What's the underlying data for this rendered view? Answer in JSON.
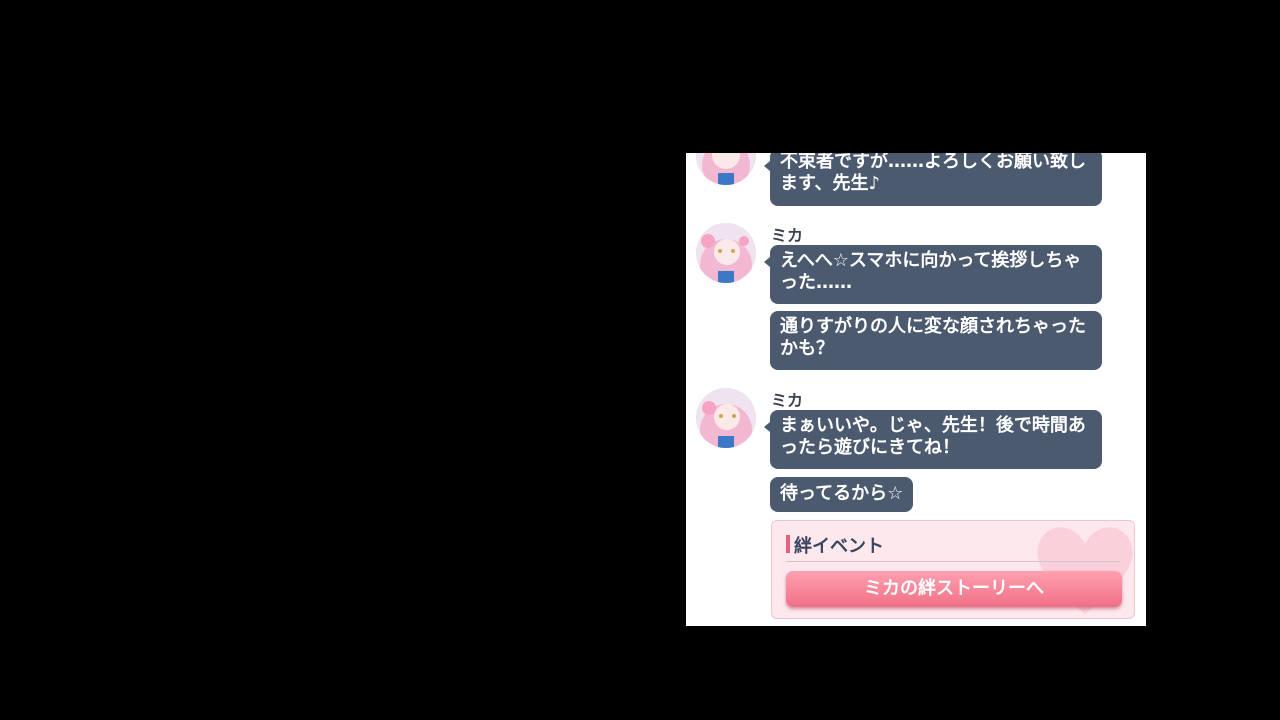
{
  "chat": {
    "partial_message": {
      "text": "不束者ですが……よろしくお願い致します、先生♪"
    },
    "groups": [
      {
        "sender": "ミカ",
        "messages": [
          "えへへ☆スマホに向かって挨拶しちゃった……",
          "通りすがりの人に変な顔されちゃったかも？"
        ]
      },
      {
        "sender": "ミカ",
        "messages": [
          "まぁいいや。じゃ、先生！後で時間あったら遊びにきてね！",
          "待ってるから☆"
        ]
      }
    ]
  },
  "bond_event": {
    "title": "絆イベント",
    "button_label": "ミカの絆ストーリーへ"
  },
  "colors": {
    "bubble": "#4c5a70",
    "bond_button": "#f07086",
    "bond_card": "#fde8ee"
  }
}
